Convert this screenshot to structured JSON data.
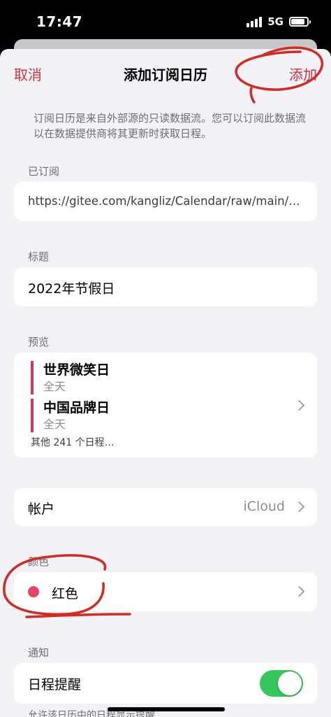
{
  "status_bar": {
    "time": "17:47",
    "network": "5G",
    "battery_level": 0.85
  },
  "nav": {
    "cancel": "取消",
    "title": "添加订阅日历",
    "add": "添加"
  },
  "description": "订阅日历是来自外部源的只读数据流。您可以订阅此数据流以在数据提供商将其更新时获取日程。",
  "subscribed": {
    "label": "已订阅",
    "url": "https://gitee.com/kangliz/Calendar/raw/main/calendar.ics"
  },
  "title_section": {
    "label": "标题",
    "value": "2022年节假日"
  },
  "preview": {
    "label": "预览",
    "events": [
      {
        "name": "世界微笑日",
        "time": "全天"
      },
      {
        "name": "中国品牌日",
        "time": "全天"
      }
    ],
    "more": "其他 241 个日程…"
  },
  "account": {
    "label": "帐户",
    "value": "iCloud"
  },
  "color": {
    "label": "颜色",
    "value": "红色",
    "swatch": "#e8416a"
  },
  "notify": {
    "label": "通知",
    "row_label": "日程提醒",
    "enabled": true
  },
  "footer_note": "允许该日历中的日程显示提醒",
  "colors": {
    "accent": "#d0313a",
    "toggle_on": "#34c759",
    "annotation": "#d42a22"
  }
}
